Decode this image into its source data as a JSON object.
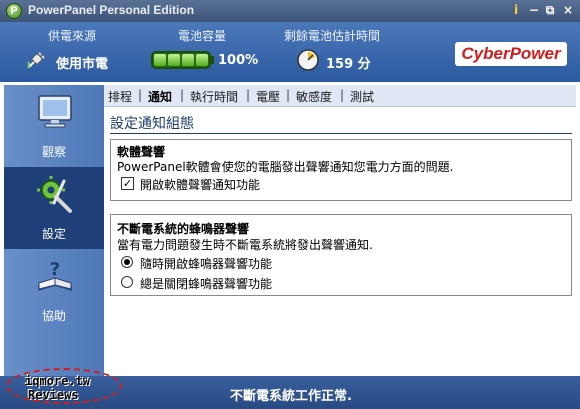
{
  "window": {
    "title": "PowerPanel Personal Edition",
    "logo_letter": "P",
    "buttons": {
      "info": "i",
      "minimize": "−",
      "restore": "⧉",
      "close": "×"
    }
  },
  "status": {
    "power_source_label": "供電來源",
    "power_source_value": "使用市電",
    "battery_label": "電池容量",
    "battery_value": "100%",
    "runtime_label": "剩餘電池估計時間",
    "runtime_value": "159 分",
    "brand": "CyberPower",
    "battery_level": 1.0
  },
  "nav": {
    "items": [
      {
        "label": "觀察",
        "icon": "monitor-icon"
      },
      {
        "label": "設定",
        "icon": "tools-icon"
      },
      {
        "label": "協助",
        "icon": "help-book-icon"
      }
    ],
    "active": "設定"
  },
  "tabs": {
    "items": [
      "排程",
      "通知",
      "執行時間",
      "電壓",
      "敏感度",
      "測試"
    ],
    "active": "通知",
    "separator": "|"
  },
  "content": {
    "title": "設定通知組態",
    "software_beep": {
      "title": "軟體聲響",
      "description": "PowerPanel軟體會使您的電腦發出聲響通知您電力方面的問題.",
      "checkbox_label": "開啟軟體聲響通知功能",
      "checked": true
    },
    "ups_beeper": {
      "title": "不斷電系統的蜂鳴器聲響",
      "description": "當有電力問題發生時不斷電系統將發出聲響通知.",
      "options": [
        "隨時開啟蜂鳴器聲響功能",
        "總是關閉蜂鳴器聲響功能"
      ],
      "selected": "隨時開啟蜂鳴器聲響功能"
    }
  },
  "statusbar": {
    "message": "不斷電系統工作正常."
  },
  "watermark": {
    "line1": "iqmore.tw",
    "line2": "Reviews"
  },
  "colors": {
    "header_blue": "#2c5aa0",
    "brand_red": "#d01e1e",
    "battery_green": "#4fae1d"
  }
}
